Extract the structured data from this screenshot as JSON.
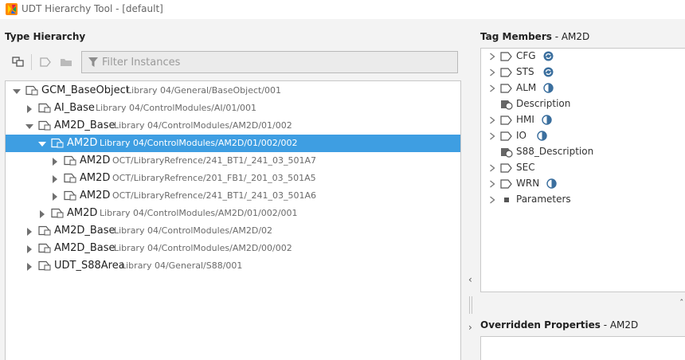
{
  "window": {
    "title": "UDT Hierarchy Tool - [default]"
  },
  "type_hierarchy": {
    "title": "Type Hierarchy",
    "filter_placeholder": "Filter Instances",
    "rows": [
      {
        "name": "GCM_BaseObject",
        "path": "Library 04/General/BaseObject/001",
        "expanded": true,
        "selected": false
      },
      {
        "name": "AI_Base",
        "path": "Library 04/ControlModules/AI/01/001",
        "expanded": false,
        "selected": false
      },
      {
        "name": "AM2D_Base",
        "path": "Library 04/ControlModules/AM2D/01/002",
        "expanded": true,
        "selected": false
      },
      {
        "name": "AM2D",
        "path": "Library 04/ControlModules/AM2D/01/002/002",
        "expanded": true,
        "selected": true
      },
      {
        "name": "AM2D",
        "path": "OCT/LibraryRefrence/241_BT1/_241_03_501A7",
        "expanded": false,
        "selected": false
      },
      {
        "name": "AM2D",
        "path": "OCT/LibraryRefrence/201_FB1/_201_03_501A5",
        "expanded": false,
        "selected": false
      },
      {
        "name": "AM2D",
        "path": "OCT/LibraryRefrence/241_BT1/_241_03_501A6",
        "expanded": false,
        "selected": false
      },
      {
        "name": "AM2D",
        "path": "Library 04/ControlModules/AM2D/01/002/001",
        "expanded": false,
        "selected": false
      },
      {
        "name": "AM2D_Base",
        "path": "Library 04/ControlModules/AM2D/02",
        "expanded": false,
        "selected": false
      },
      {
        "name": "AM2D_Base",
        "path": "Library 04/ControlModules/AM2D/00/002",
        "expanded": false,
        "selected": false
      },
      {
        "name": "UDT_S88Area",
        "path": "Library 04/General/S88/001",
        "expanded": false,
        "selected": false
      }
    ]
  },
  "tag_members": {
    "title": "Tag Members",
    "title_suffix": " - AM2D",
    "items": [
      {
        "name": "CFG",
        "kind": "folder",
        "badge": "sync"
      },
      {
        "name": "STS",
        "kind": "folder",
        "badge": "sync"
      },
      {
        "name": "ALM",
        "kind": "folder",
        "badge": "half"
      },
      {
        "name": "Description",
        "kind": "memory-tag",
        "badge": ""
      },
      {
        "name": "HMI",
        "kind": "folder",
        "badge": "half"
      },
      {
        "name": "IO",
        "kind": "folder",
        "badge": "half"
      },
      {
        "name": "S88_Description",
        "kind": "memory-tag",
        "badge": ""
      },
      {
        "name": "SEC",
        "kind": "folder",
        "badge": ""
      },
      {
        "name": "WRN",
        "kind": "folder",
        "badge": "half"
      },
      {
        "name": "Parameters",
        "kind": "params",
        "badge": ""
      }
    ]
  },
  "overridden_properties": {
    "title": "Overridden Properties",
    "title_suffix": " - AM2D"
  },
  "colors": {
    "selection": "#3e9ee2",
    "accent_badge": "#3b6f9e"
  }
}
